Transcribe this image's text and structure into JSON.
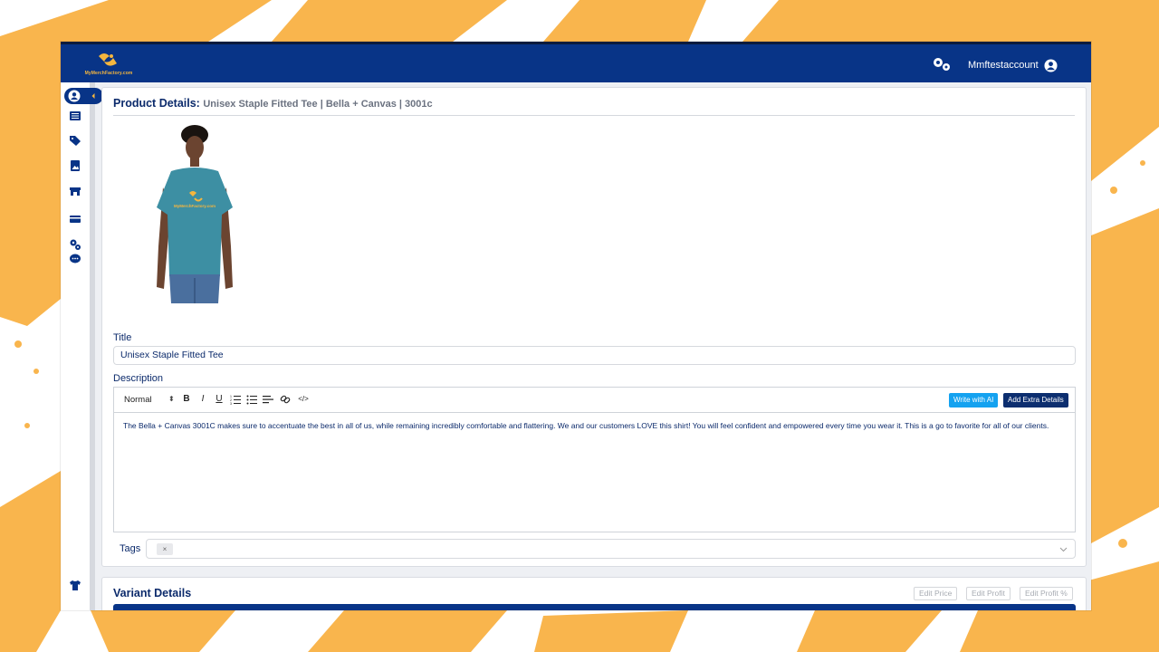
{
  "brand": {
    "logo_text": "MyMerchFactory.com"
  },
  "header": {
    "account_name": "Mmftestaccount"
  },
  "sidebar": {
    "icons": [
      "user-icon",
      "list-icon",
      "tags-icon",
      "image-icon",
      "store-icon",
      "credit-card-icon",
      "gears-icon",
      "chat-icon",
      "tshirt-icon"
    ]
  },
  "product": {
    "heading_label": "Product Details:",
    "heading_sub": "Unisex Staple Fitted Tee | Bella + Canvas | 3001c",
    "title_label": "Title",
    "title_value": "Unisex Staple Fitted Tee",
    "description_label": "Description",
    "editor": {
      "format_select": "Normal",
      "write_ai_label": "Write with AI",
      "extra_details_label": "Add Extra Details",
      "body": "The Bella + Canvas 3001C makes sure to accentuate the best in all of us, while remaining incredibly comfortable and flattering. We and our customers LOVE this shirt! You will feel confident and empowered every time you wear it. This is a go to favorite for all of our clients."
    },
    "tags_label": "Tags",
    "tag_remove": "×",
    "tshirt_print": "MyMerchFactory.com"
  },
  "variants": {
    "title": "Variant Details",
    "edit_price": "Edit Price",
    "edit_profit": "Edit Profit",
    "edit_profit_pct": "Edit Profit %"
  },
  "colors": {
    "navy": "#083487",
    "accent_orange": "#f9b54d",
    "ai_blue": "#14a2f0"
  }
}
